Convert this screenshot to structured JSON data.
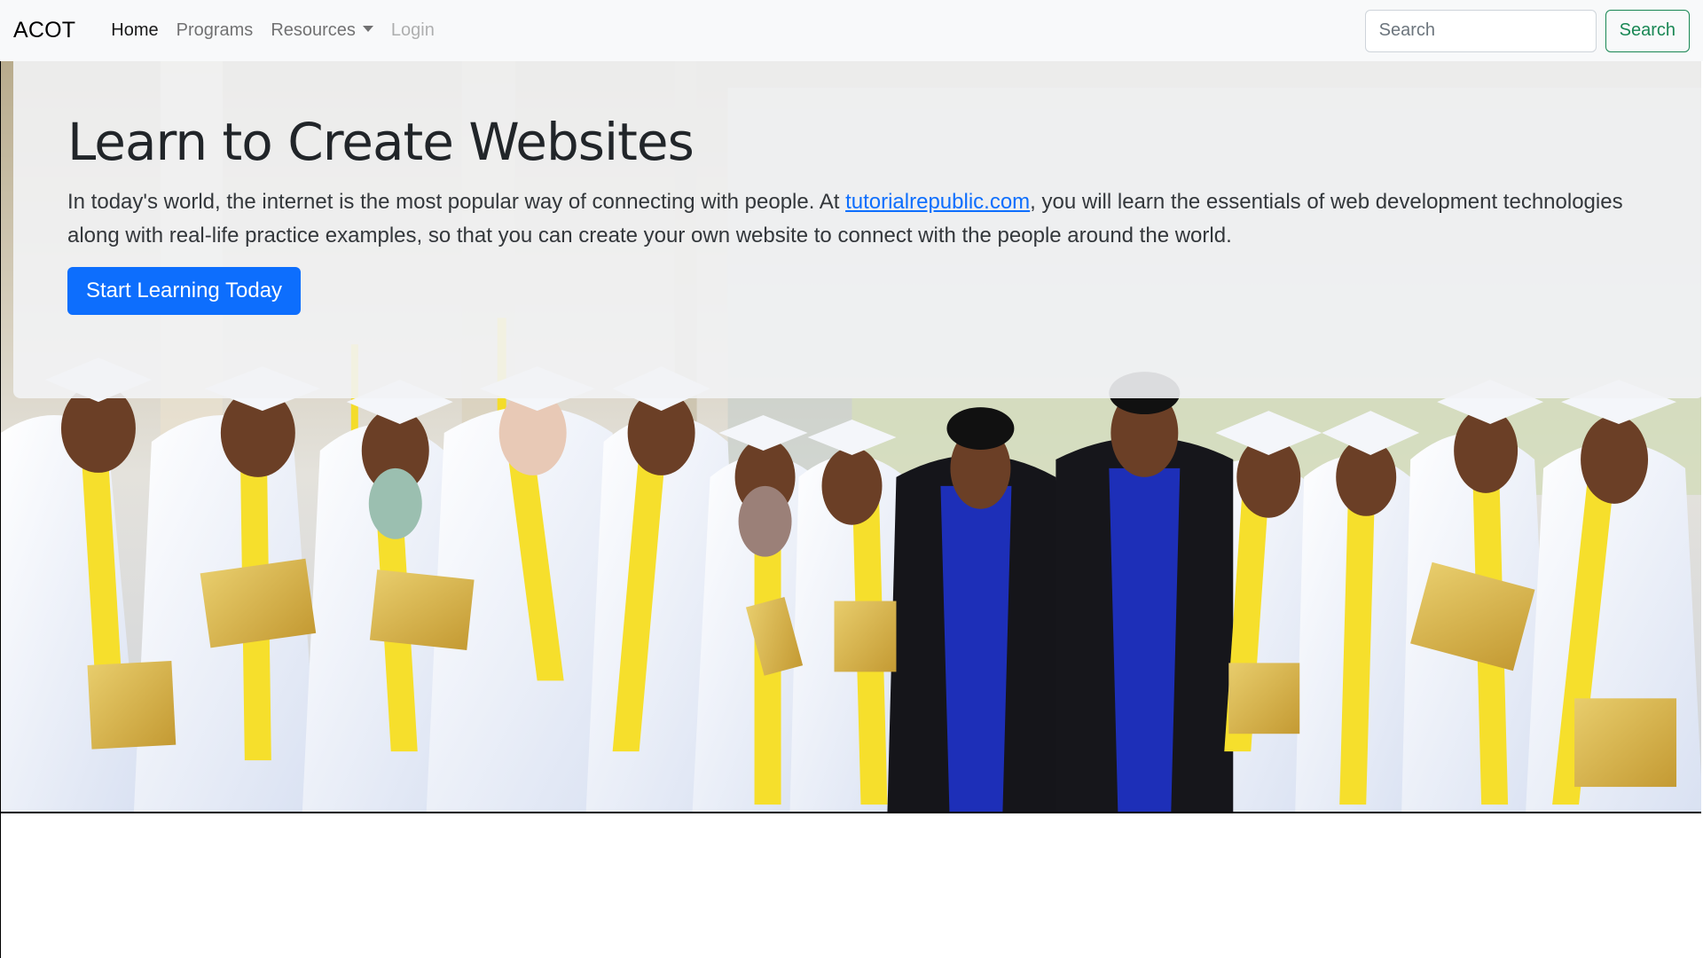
{
  "navbar": {
    "brand": "ACOT",
    "links": [
      {
        "label": "Home",
        "state": "active"
      },
      {
        "label": "Programs",
        "state": "normal"
      },
      {
        "label": "Resources",
        "state": "dropdown"
      },
      {
        "label": "Login",
        "state": "disabled"
      }
    ],
    "search": {
      "placeholder": "Search",
      "button_label": "Search"
    }
  },
  "hero": {
    "title": "Learn to Create Websites",
    "lead_before": "In today's world, the internet is the most popular way of connecting with people. At ",
    "lead_link": "tutorialrepublic.com",
    "lead_after": ", you will learn the essentials of web development technologies along with real-life practice examples, so that you can create your own website to connect with the people around the world.",
    "cta_label": "Start Learning Today",
    "background_image": "graduation-group-photo"
  },
  "colors": {
    "primary": "#0d6efd",
    "success": "#198754",
    "navbar_bg": "#f8f9fa",
    "gown_white": "#eef2fb",
    "stole_yellow": "#f6df2c",
    "diploma_gold": "#d4b24a",
    "faculty_blue": "#1d2fb8"
  }
}
